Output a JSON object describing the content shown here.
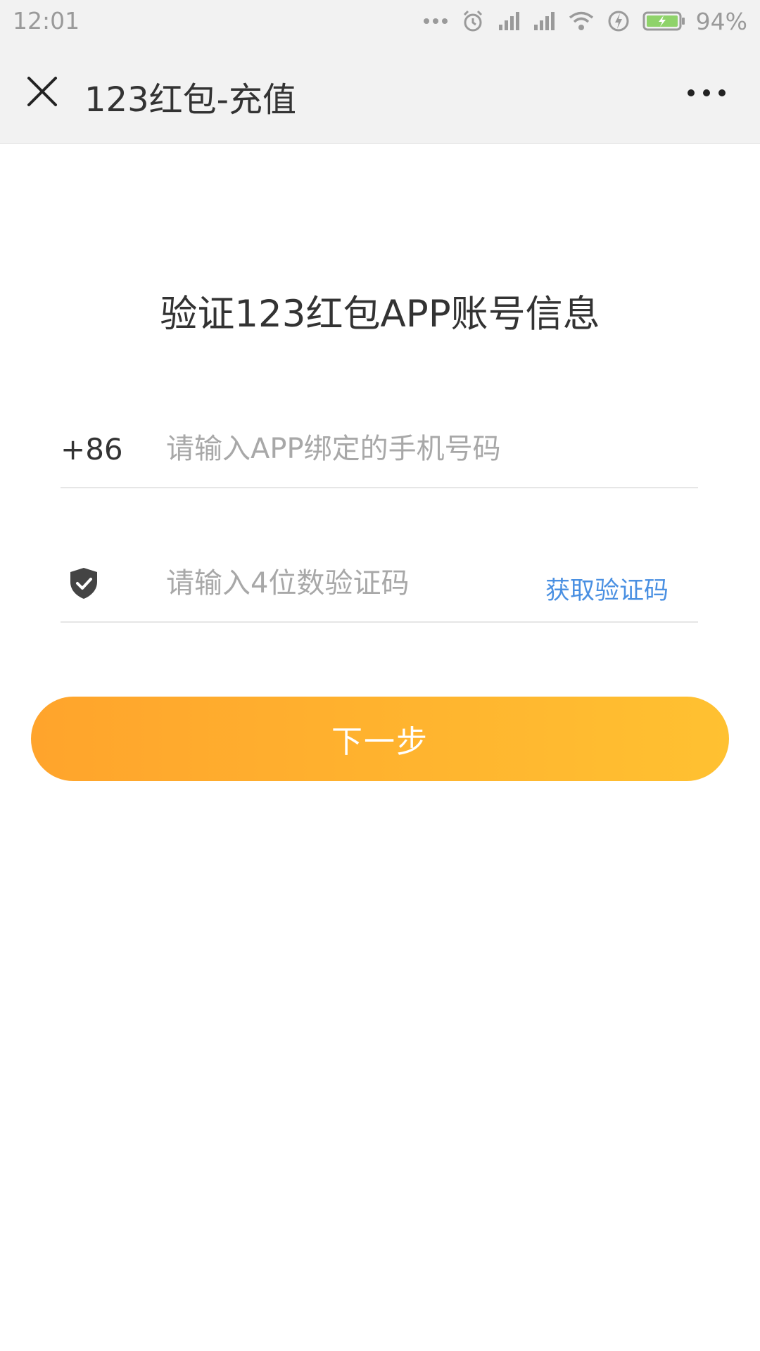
{
  "status_bar": {
    "time": "12:01",
    "battery_percent": "94%",
    "icons": [
      "more-dots-icon",
      "alarm-icon",
      "signal-icon",
      "signal-icon",
      "wifi-icon",
      "charging-icon",
      "battery-icon"
    ]
  },
  "nav": {
    "title": "123红包-充值",
    "close_icon": "close-icon",
    "more_icon": "more-icon"
  },
  "main": {
    "title": "验证123红包APP账号信息",
    "phone": {
      "country_code": "+86",
      "placeholder": "请输入APP绑定的手机号码",
      "value": ""
    },
    "code": {
      "icon": "shield-check-icon",
      "placeholder": "请输入4位数验证码",
      "value": "",
      "get_code_label": "获取验证码"
    },
    "next_label": "下一步"
  },
  "colors": {
    "accent_start": "#ffa42c",
    "accent_end": "#ffc131",
    "link": "#4a90e2",
    "nav_bg": "#f2f2f2"
  }
}
